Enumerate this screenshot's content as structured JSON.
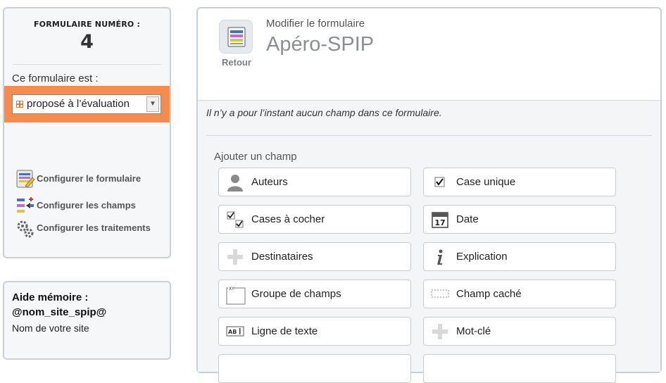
{
  "sidebar": {
    "form_number_label": "FORMULAIRE NUMÉRO :",
    "form_number": "4",
    "status_label": "Ce formulaire est :",
    "status_value": "proposé à l’évaluation",
    "status_color": "#f58b4c",
    "links": [
      {
        "label": "Configurer le formulaire",
        "icon": "form-config-icon"
      },
      {
        "label": "Configurer les champs",
        "icon": "fields-config-icon"
      },
      {
        "label": "Configurer les traitements",
        "icon": "gears-icon"
      }
    ]
  },
  "aide": {
    "title": "Aide mémoire :",
    "code": "@nom_site_spip@",
    "description": "Nom de votre site"
  },
  "header": {
    "back_label": "Retour",
    "subtitle": "Modifier le formulaire",
    "title": "Apéro-SPIP"
  },
  "main": {
    "empty_message": "Il n’y a pour l’instant aucun champ dans ce formulaire.",
    "add_field_label": "Ajouter un champ",
    "field_types": [
      {
        "label": "Auteurs",
        "icon": "user-icon"
      },
      {
        "label": "Case unique",
        "icon": "checkbox-icon"
      },
      {
        "label": "Cases à cocher",
        "icon": "checkboxes-icon"
      },
      {
        "label": "Date",
        "icon": "calendar-icon"
      },
      {
        "label": "Destinataires",
        "icon": "plus-icon"
      },
      {
        "label": "Explication",
        "icon": "info-icon"
      },
      {
        "label": "Groupe de champs",
        "icon": "fieldset-icon"
      },
      {
        "label": "Champ caché",
        "icon": "hidden-field-icon"
      },
      {
        "label": "Ligne de texte",
        "icon": "text-line-icon"
      },
      {
        "label": "Mot-clé",
        "icon": "plus-icon"
      }
    ]
  }
}
